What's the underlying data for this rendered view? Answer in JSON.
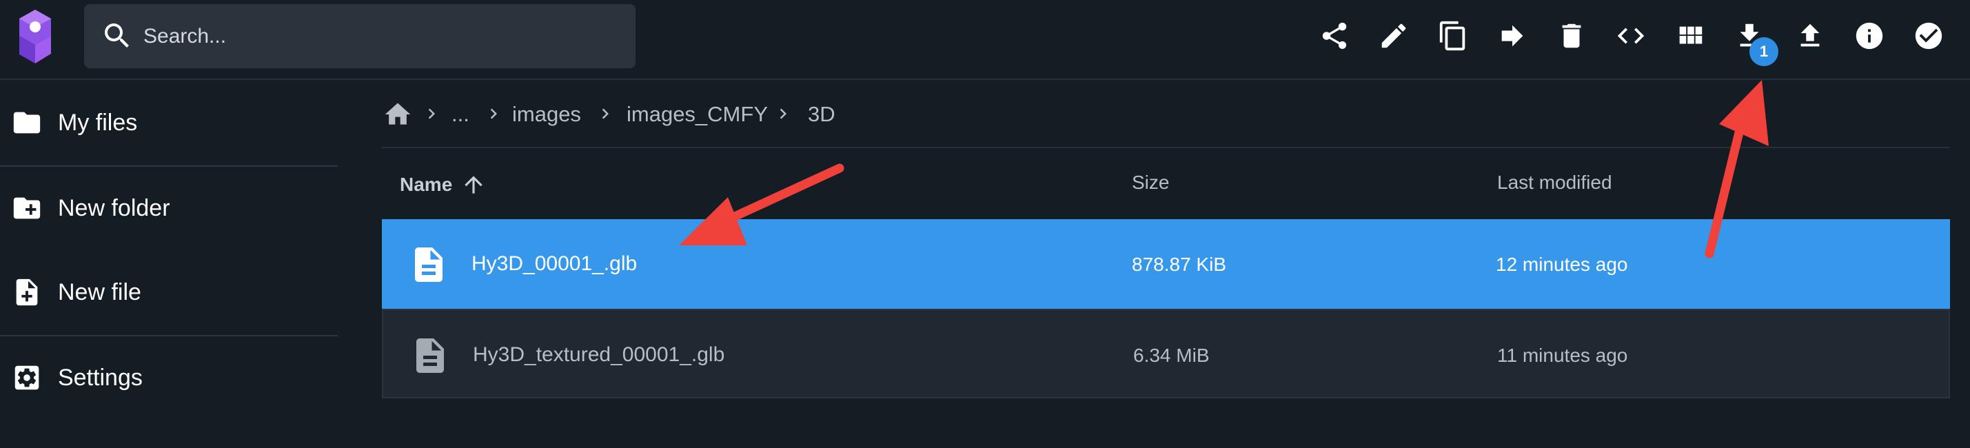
{
  "search": {
    "placeholder": "Search..."
  },
  "toolbar": {
    "actions": [
      {
        "icon": "share-icon",
        "label": "Share"
      },
      {
        "icon": "pencil-icon",
        "label": "Rename"
      },
      {
        "icon": "copy-icon",
        "label": "Copy"
      },
      {
        "icon": "arrow-right-icon",
        "label": "Move"
      },
      {
        "icon": "trash-icon",
        "label": "Delete"
      },
      {
        "icon": "code-icon",
        "label": "Code"
      },
      {
        "icon": "grid-view-icon",
        "label": "Switch view"
      },
      {
        "icon": "download-icon",
        "label": "Download"
      },
      {
        "icon": "upload-icon",
        "label": "Upload"
      },
      {
        "icon": "info-icon",
        "label": "Info"
      },
      {
        "icon": "check-circle-icon",
        "label": "Select multiple"
      }
    ],
    "download_badge": "1"
  },
  "sidebar": {
    "items": [
      {
        "icon": "folder-icon",
        "label": "My files"
      },
      {
        "icon": "new-folder-icon",
        "label": "New folder"
      },
      {
        "icon": "new-file-icon",
        "label": "New file"
      },
      {
        "icon": "settings-icon",
        "label": "Settings"
      }
    ]
  },
  "breadcrumb": {
    "items": [
      "...",
      "images",
      "images_CMFY",
      "3D"
    ]
  },
  "table": {
    "headers": {
      "name": "Name",
      "size": "Size",
      "modified": "Last modified"
    },
    "rows": [
      {
        "name": "Hy3D_00001_.glb",
        "size": "878.87 KiB",
        "modified": "12 minutes ago",
        "selected": true
      },
      {
        "name": "Hy3D_textured_00001_.glb",
        "size": "6.34 MiB",
        "modified": "11 minutes ago",
        "selected": false
      }
    ]
  },
  "colors": {
    "background": "#141c24",
    "selected_row": "#3797eb",
    "badge": "#2f8de4",
    "annotation_arrow": "#f0413a"
  }
}
